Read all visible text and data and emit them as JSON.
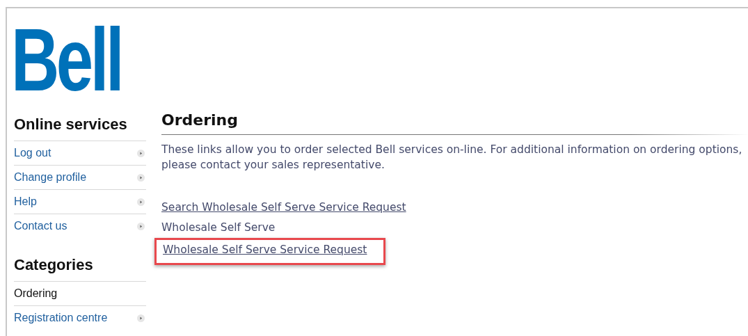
{
  "logo": {
    "text": "Bell"
  },
  "sidebar": {
    "sections": [
      {
        "title": "Online services",
        "items": [
          {
            "label": "Log out",
            "selected": false
          },
          {
            "label": "Change profile",
            "selected": false
          },
          {
            "label": "Help",
            "selected": false
          },
          {
            "label": "Contact us",
            "selected": false
          }
        ]
      },
      {
        "title": "Categories",
        "items": [
          {
            "label": "Ordering",
            "selected": true
          },
          {
            "label": "Registration centre",
            "selected": false
          }
        ]
      }
    ]
  },
  "main": {
    "title": "Ordering",
    "intro": "These links allow you to order selected Bell services on-line. For additional information on ordering options, please contact your sales representative.",
    "links": [
      {
        "label": "Search Wholesale Self Serve Service Request",
        "kind": "link",
        "highlighted": false
      },
      {
        "label": "Wholesale Self Serve",
        "kind": "text",
        "highlighted": false
      },
      {
        "label": "Wholesale Self Serve Service Request",
        "kind": "link",
        "highlighted": true
      }
    ]
  }
}
